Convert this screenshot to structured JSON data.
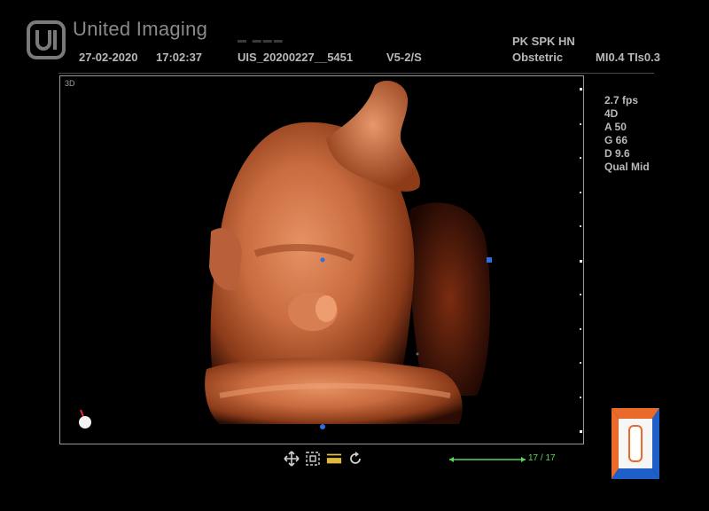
{
  "brand": {
    "name": "United Imaging",
    "logo_icon": "united-imaging-logo-icon"
  },
  "header": {
    "date": "27-02-2020",
    "time": "17:02:37",
    "study_id": "UIS_20200227__5451",
    "probe": "V5-2/S",
    "patient": "PK SPK HN",
    "exam": "Obstetric",
    "mi_tis": "MI0.4  TIs0.3"
  },
  "viewport": {
    "mode": "3D"
  },
  "params": [
    "2.7 fps",
    "4D",
    "A 50",
    "G 66",
    "D 9.6",
    "Qual Mid"
  ],
  "toolbar": {
    "icons": [
      "move-icon",
      "zoom-box-icon",
      "cut-icon",
      "rotate-icon"
    ]
  },
  "cine": {
    "label": "17 / 17",
    "progress": 1.0
  },
  "colors": {
    "tissue": "#c9764c",
    "cine_green": "#5bd65b",
    "marker_blue": "#2b6fe0",
    "orient_orange": "#ea6a2b",
    "orient_blue": "#1f5fc8"
  }
}
